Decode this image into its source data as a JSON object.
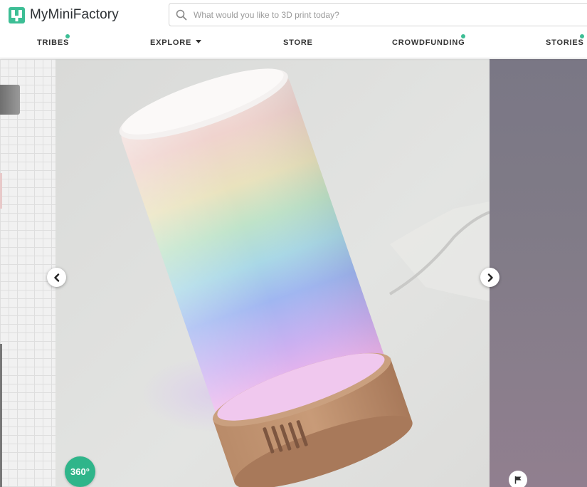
{
  "header": {
    "brand": "MyMiniFactory",
    "brand_color": "#3dbe95",
    "search_placeholder": "What would you like to 3D print today?",
    "nav": [
      {
        "label": "TRIBES",
        "dot": true
      },
      {
        "label": "EXPLORE",
        "dropdown": true
      },
      {
        "label": "STORE"
      },
      {
        "label": "CROWDFUNDING",
        "dot": true
      },
      {
        "label": "STORIES",
        "dot": true
      }
    ]
  },
  "gallery": {
    "badge_360": "360°",
    "prev_icon": "chevron-left-icon",
    "next_icon": "chevron-right-icon",
    "report_icon": "flag-icon",
    "accent_color": "#2fb58a"
  }
}
